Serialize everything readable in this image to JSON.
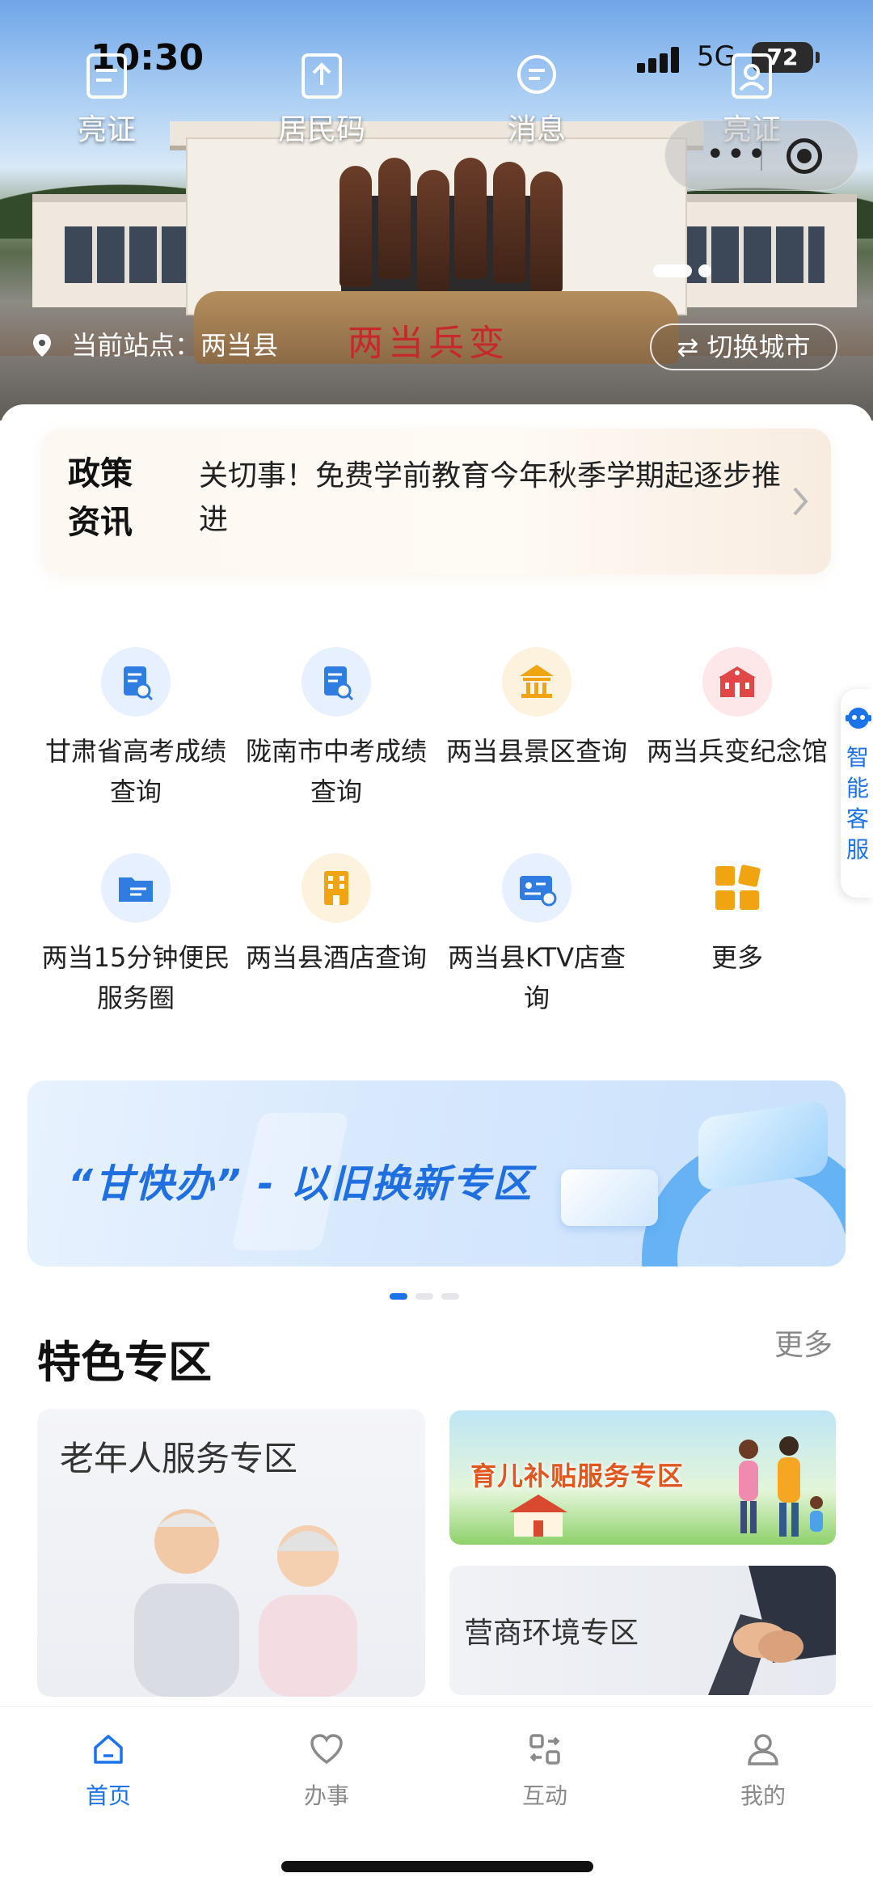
{
  "status_bar": {
    "time": "10:30",
    "network": "5G",
    "battery": "72"
  },
  "hero": {
    "quick_actions": [
      {
        "label": "亮证",
        "icon": "document-icon"
      },
      {
        "label": "居民码",
        "icon": "upload-icon"
      },
      {
        "label": "消息",
        "icon": "message-icon"
      },
      {
        "label": "亮证",
        "icon": "id-card-icon"
      }
    ],
    "station_text": "当前站点：两当县",
    "switch_city_label": "⇄ 切换城市",
    "rock_inscription": "两当兵变"
  },
  "policy": {
    "tag": "政策资讯",
    "headline": "关切事！免费学前教育今年秋季学期起逐步推进"
  },
  "services": [
    {
      "label": "甘肃省高考成绩查询",
      "icon": "doc-search-icon",
      "bg": "#e7f0fe"
    },
    {
      "label": "陇南市中考成绩查询",
      "icon": "doc-search-icon",
      "bg": "#e7f0fe"
    },
    {
      "label": "两当县景区查询",
      "icon": "temple-icon",
      "bg": "#fdf2de"
    },
    {
      "label": "两当兵变纪念馆",
      "icon": "museum-icon",
      "bg": "#fde7e8"
    },
    {
      "label": "两当15分钟便民服务圈",
      "icon": "folder-icon",
      "bg": "#e7f0fe"
    },
    {
      "label": "两当县酒店查询",
      "icon": "hotel-icon",
      "bg": "#fdf2de"
    },
    {
      "label": "两当县KTV店查询",
      "icon": "ktv-card-icon",
      "bg": "#e7f0fe"
    },
    {
      "label": "更多",
      "icon": "grid-more-icon",
      "bg": "transparent"
    }
  ],
  "assistant": {
    "label": "智能客服"
  },
  "banner": {
    "title": "“甘快办” - 以旧换新专区"
  },
  "featured": {
    "title": "特色专区",
    "more": "更多",
    "elderly": "老年人服务专区",
    "childcare": "育儿补贴服务专区",
    "business": "营商环境专区"
  },
  "tabbar": {
    "items": [
      {
        "label": "首页",
        "icon": "home-icon",
        "active": true
      },
      {
        "label": "办事",
        "icon": "heart-icon",
        "active": false
      },
      {
        "label": "互动",
        "icon": "interaction-icon",
        "active": false
      },
      {
        "label": "我的",
        "icon": "user-icon",
        "active": false
      }
    ]
  },
  "colors": {
    "accent": "#1a73e8",
    "gold": "#f0a410",
    "red": "#e04848"
  }
}
